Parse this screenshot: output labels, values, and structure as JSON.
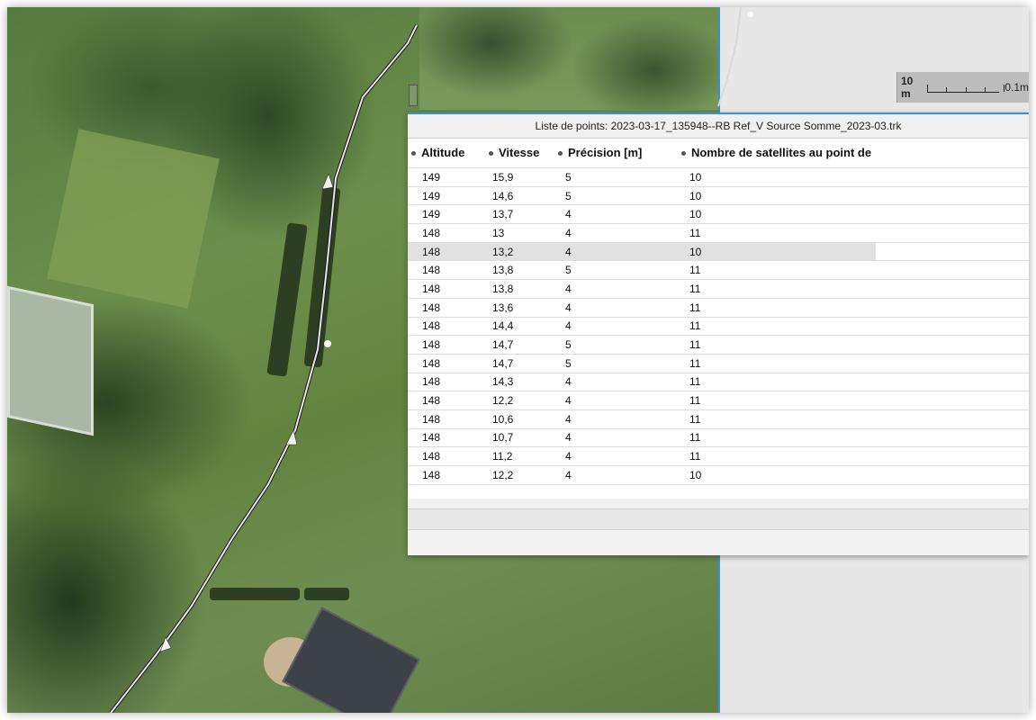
{
  "map": {
    "scale_value": "10 m",
    "scale_secondary": "0.1m"
  },
  "point_list": {
    "title": "Liste de points: 2023-03-17_135948--RB Ref_V Source Somme_2023-03.trk",
    "columns": [
      "Altitude",
      "Vitesse",
      "Précision [m]",
      "Nombre de satellites au point de"
    ],
    "rows": [
      {
        "altitude": "149",
        "vitesse": "15,9",
        "precision": "5",
        "satellites": "10"
      },
      {
        "altitude": "149",
        "vitesse": "14,6",
        "precision": "5",
        "satellites": "10"
      },
      {
        "altitude": "149",
        "vitesse": "13,7",
        "precision": "4",
        "satellites": "10"
      },
      {
        "altitude": "148",
        "vitesse": "13",
        "precision": "4",
        "satellites": "11"
      },
      {
        "altitude": "148",
        "vitesse": "13,2",
        "precision": "4",
        "satellites": "10"
      },
      {
        "altitude": "148",
        "vitesse": "13,8",
        "precision": "5",
        "satellites": "11"
      },
      {
        "altitude": "148",
        "vitesse": "13,8",
        "precision": "4",
        "satellites": "11"
      },
      {
        "altitude": "148",
        "vitesse": "13,6",
        "precision": "4",
        "satellites": "11"
      },
      {
        "altitude": "148",
        "vitesse": "14,4",
        "precision": "4",
        "satellites": "11"
      },
      {
        "altitude": "148",
        "vitesse": "14,7",
        "precision": "5",
        "satellites": "11"
      },
      {
        "altitude": "148",
        "vitesse": "14,7",
        "precision": "5",
        "satellites": "11"
      },
      {
        "altitude": "148",
        "vitesse": "14,3",
        "precision": "4",
        "satellites": "11"
      },
      {
        "altitude": "148",
        "vitesse": "12,2",
        "precision": "4",
        "satellites": "11"
      },
      {
        "altitude": "148",
        "vitesse": "10,6",
        "precision": "4",
        "satellites": "11"
      },
      {
        "altitude": "148",
        "vitesse": "10,7",
        "precision": "4",
        "satellites": "11"
      },
      {
        "altitude": "148",
        "vitesse": "11,2",
        "precision": "4",
        "satellites": "11"
      },
      {
        "altitude": "148",
        "vitesse": "12,2",
        "precision": "4",
        "satellites": "10"
      }
    ],
    "selected_row_index": 4
  }
}
